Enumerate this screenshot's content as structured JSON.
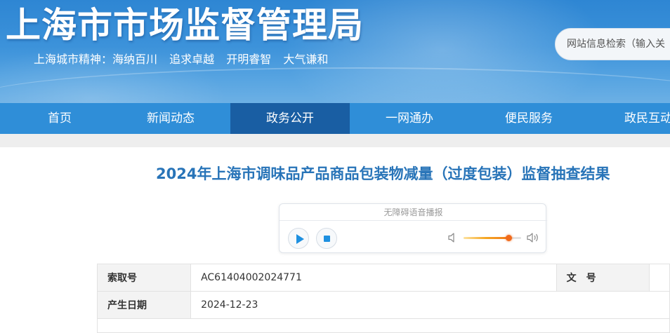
{
  "header": {
    "site_title": "上海市市场监督管理局",
    "slogan": [
      "上海城市精神：海纳百川",
      "追求卓越",
      "开明睿智",
      "大气谦和"
    ],
    "search_placeholder": "网站信息检索（输入关"
  },
  "nav": {
    "items": [
      {
        "label": "首页",
        "active": false
      },
      {
        "label": "新闻动态",
        "active": false
      },
      {
        "label": "政务公开",
        "active": true
      },
      {
        "label": "一网通办",
        "active": false
      },
      {
        "label": "便民服务",
        "active": false
      },
      {
        "label": "政民互动",
        "active": false
      }
    ]
  },
  "article": {
    "title": "2024年上海市调味品产品商品包装物减量（过度包装）监督抽查结果"
  },
  "player": {
    "label": "无障碍语音播报",
    "volume_percent": 78,
    "icons": [
      "play-icon",
      "stop-icon",
      "volume-low-icon",
      "volume-high-icon"
    ]
  },
  "meta_table": {
    "rows": [
      {
        "label": "索取号",
        "value": "AC61404002024771",
        "label2": "文号",
        "value2": ""
      },
      {
        "label": "产生日期",
        "value": "2024-12-23"
      }
    ]
  },
  "colors": {
    "header_blue": "#2e86d3",
    "nav_blue": "#2f8ed8",
    "nav_active": "#195ea3",
    "title_blue": "#2874b8",
    "player_accent": "#1e90e0",
    "volume_orange": "#f07a1c"
  }
}
